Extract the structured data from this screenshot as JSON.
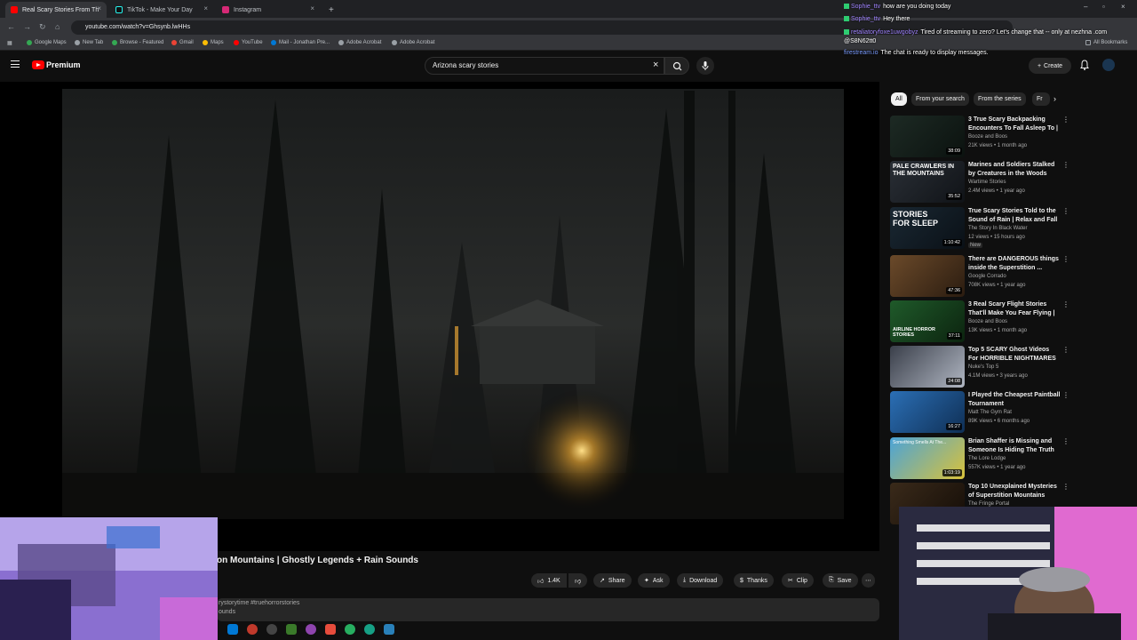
{
  "browser": {
    "tabs": [
      {
        "title": "Real Scary Stories From Th",
        "active": true
      },
      {
        "title": "TikTok - Make Your Day",
        "active": false
      },
      {
        "title": "Instagram",
        "active": false
      }
    ],
    "new_tab": "+",
    "url": "youtube.com/watch?v=Ghsynb.lwHHs",
    "bookmarks": [
      "Google Maps",
      "New Tab",
      "Browse - Featured",
      "Gmail",
      "Maps",
      "YouTube",
      "Mail - Jonathan Pre...",
      "Adobe Acrobat",
      "Adobe Acrobat"
    ],
    "all_bookmarks": "All Bookmarks"
  },
  "header": {
    "brand": "Premium",
    "search_value": "Arizona scary stories",
    "create_label": "Create"
  },
  "video": {
    "title_fragment": "on Mountains | Ghostly Legends + Rain Sounds",
    "likes": "1.4K",
    "actions": {
      "share": "Share",
      "ask": "Ask",
      "download": "Download",
      "thanks": "Thanks",
      "clip": "Clip",
      "save": "Save"
    },
    "desc_tags": "rystorytime #truehorrorstories",
    "desc_sub": "ounds"
  },
  "chips": [
    "All",
    "From your search",
    "From the series",
    "Fr"
  ],
  "recommendations": [
    {
      "title": "3 True Scary Backpacking Encounters To Fall Asleep To | ...",
      "channel": "Booze and Boos",
      "meta": "21K views • 1 month ago",
      "duration": "38:09",
      "colors": [
        "#1d2a24",
        "#0b120f"
      ]
    },
    {
      "title": "Marines and Soldiers Stalked by Creatures in the Woods",
      "channel": "Wartime Stories",
      "meta": "2.4M views • 1 year ago",
      "duration": "35:52",
      "colors": [
        "#2a2f36",
        "#101317"
      ],
      "thumb_text": "PALE CRAWLERS IN THE MOUNTAINS"
    },
    {
      "title": "True Scary Stories Told to the Sound of Rain | Relax and Fall ...",
      "channel": "The Story In Black Water",
      "meta": "12 views • 15 hours ago",
      "extra": "New",
      "duration": "1:10:42",
      "colors": [
        "#1a2833",
        "#0a1016"
      ],
      "thumb_text": "STORIES FOR SLEEP"
    },
    {
      "title": "There are DANGEROUS things inside the Superstition ...",
      "channel": "Google Corrado",
      "meta": "708K views • 1 year ago",
      "duration": "47:36",
      "colors": [
        "#6b4a2a",
        "#2b1c10"
      ]
    },
    {
      "title": "3 Real Scary Flight Stories That'll Make You Fear Flying | ...",
      "channel": "Booze and Boos",
      "meta": "13K views • 1 month ago",
      "duration": "37:11",
      "colors": [
        "#1f5a2a",
        "#0c240f"
      ],
      "thumb_text": "AIRLINE HORROR STORIES"
    },
    {
      "title": "Top 5 SCARY Ghost Videos For HORRIBLE NIGHTMARES",
      "channel": "Nuke's Top 5",
      "meta": "4.1M views • 3 years ago",
      "duration": "24:08",
      "colors": [
        "#3a3f4a",
        "#b0b6c2"
      ]
    },
    {
      "title": "I Played the Cheapest Paintball Tournament",
      "channel": "Matt The Gym Rat",
      "meta": "89K views • 6 months ago",
      "duration": "16:27",
      "colors": [
        "#2b6fb5",
        "#0f2f55"
      ]
    },
    {
      "title": "Brian Shaffer is Missing and Someone Is Hiding The Truth",
      "channel": "The Lore Lodge",
      "meta": "557K views • 1 year ago",
      "duration": "1:03:19",
      "colors": [
        "#4aa3d8",
        "#d9c23a"
      ],
      "thumb_text": "Something Smells At The..."
    },
    {
      "title": "Top 10 Unexplained Mysteries of Superstition Mountains",
      "channel": "The Fringe Portal",
      "meta": "",
      "duration": "",
      "colors": [
        "#3a2a1a",
        "#140d07"
      ]
    }
  ],
  "chat": [
    {
      "user": "Sophie_ttv",
      "message": "how are you doing today"
    },
    {
      "user": "Sophie_ttv",
      "message": "Hey there"
    },
    {
      "user": "retaliatoryfoxe1uwgobyz",
      "message": "Tired of streaming to zero? Let's change that -- only at nezhna .com @S8N62tt0"
    },
    {
      "user": "firestream.io",
      "message": "The chat is ready to display messages."
    }
  ],
  "colors": {
    "bg": "#0f0f0f",
    "chip": "#272727",
    "brand_red": "#ff0000",
    "chat_user": "#a084ff"
  },
  "icons": [
    "tab-favicon-icon",
    "refresh-icon",
    "search-icon",
    "mic-icon",
    "bell-icon",
    "like-icon",
    "dislike-icon",
    "share-icon",
    "download-icon",
    "more-icon"
  ]
}
